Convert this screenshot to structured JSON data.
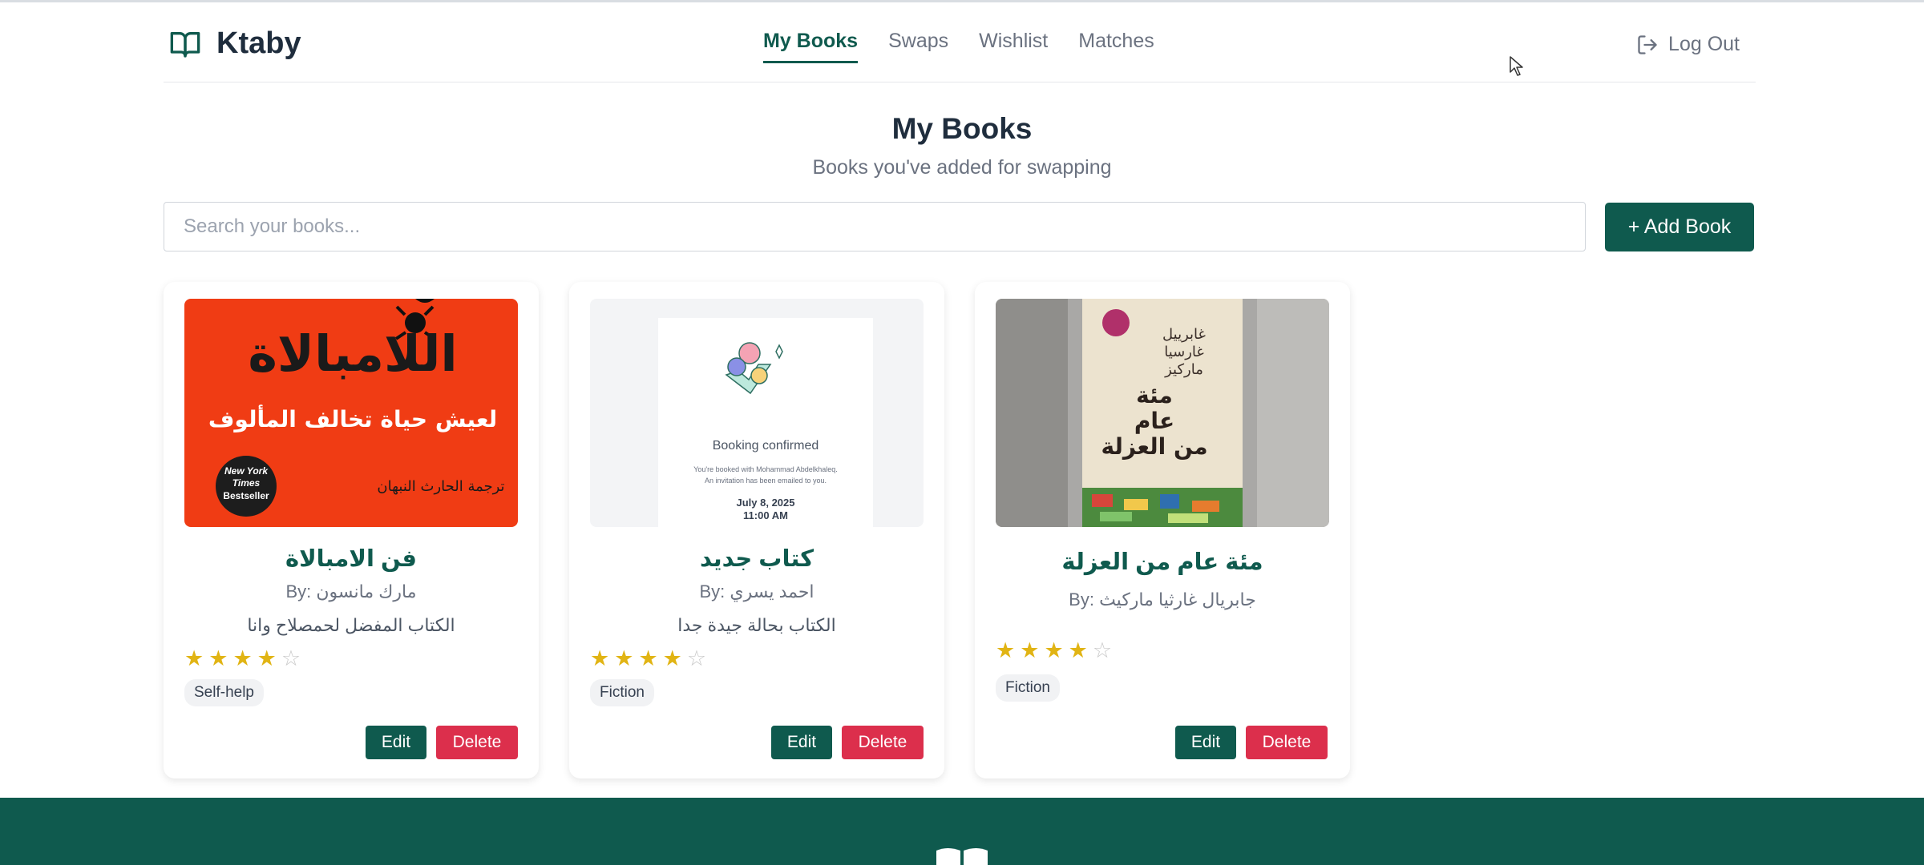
{
  "app": {
    "name": "Ktaby"
  },
  "nav": {
    "items": [
      {
        "label": "My Books",
        "active": true
      },
      {
        "label": "Swaps",
        "active": false
      },
      {
        "label": "Wishlist",
        "active": false
      },
      {
        "label": "Matches",
        "active": false
      }
    ],
    "logout_label": "Log Out"
  },
  "page": {
    "title": "My Books",
    "subtitle": "Books you've added for swapping"
  },
  "search": {
    "placeholder": "Search your books...",
    "value": ""
  },
  "add_button_label": "+ Add Book",
  "books": [
    {
      "title": "فن الامبالاة",
      "author": "By: مارك مانسون",
      "description": "الكتاب المفضل لحمصلاح وانا",
      "rating": 4,
      "rating_max": 5,
      "genre": "Self-help",
      "cover": {
        "title_text": "اللامبالاة",
        "subtitle_text": "لعيش حياة تخالف المألوف",
        "translator_text": "ترجمة الحارث النبهان",
        "badge_lines": [
          "New York",
          "Times",
          "Bestseller"
        ],
        "background_color": "#f03c14"
      },
      "edit_label": "Edit",
      "delete_label": "Delete"
    },
    {
      "title": "كتاب جديد",
      "author": "By: احمد يسري",
      "description": "الكتاب بحالة جيدة جدا",
      "rating": 4,
      "rating_max": 5,
      "genre": "Fiction",
      "cover": {
        "heading": "Booking confirmed",
        "line1": "You're booked with Mohammad Abdelkhaleq.",
        "line2": "An invitation has been emailed to you.",
        "date": "July 8, 2025",
        "time": "11:00 AM"
      },
      "edit_label": "Edit",
      "delete_label": "Delete"
    },
    {
      "title": "مئة عام من العزلة",
      "author": "By: جابريال غارثيا ماركيث",
      "description": "",
      "rating": 4,
      "rating_max": 5,
      "genre": "Fiction",
      "cover": {
        "author_line1": "غابرييل",
        "author_line2": "غارسيا",
        "author_line3": "ماركيز",
        "title_line1": "مئة",
        "title_line2": "عام",
        "title_line3": "من العزلة"
      },
      "edit_label": "Edit",
      "delete_label": "Delete"
    }
  ],
  "colors": {
    "brand": "#0f5a4e",
    "danger": "#dc2f4c",
    "star": "#e1b414"
  }
}
